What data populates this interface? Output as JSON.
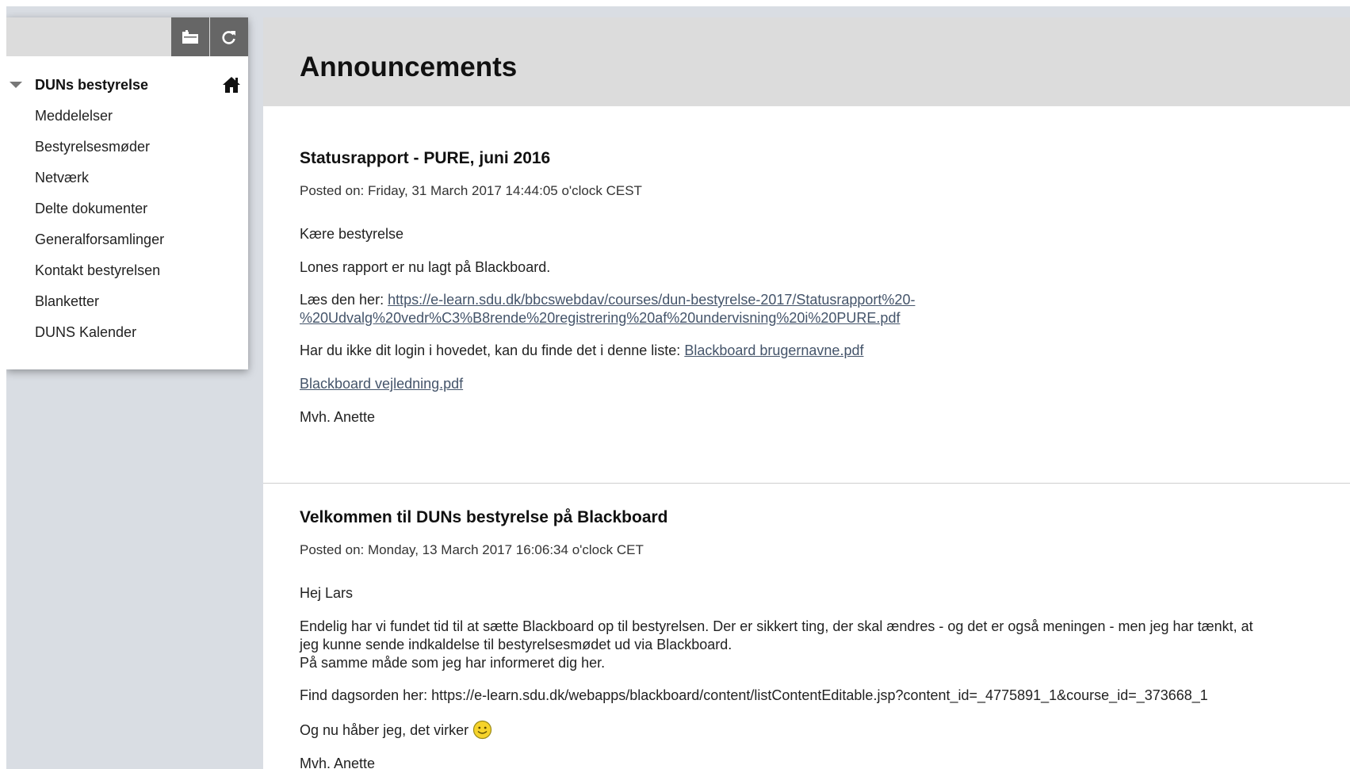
{
  "course_menu": {
    "course_title": "DUNs bestyrelse",
    "items": [
      {
        "label": "Meddelelser"
      },
      {
        "label": "Bestyrelsesmøder"
      },
      {
        "label": "Netværk"
      },
      {
        "label": "Delte dokumenter"
      },
      {
        "label": "Generalforsamlinger"
      },
      {
        "label": "Kontakt bestyrelsen"
      },
      {
        "label": "Blanketter"
      },
      {
        "label": "DUNS Kalender"
      }
    ],
    "icons": {
      "folder_view": "folder-view-icon",
      "refresh": "refresh-icon",
      "collapse": "caret-down-icon",
      "home": "home-icon"
    }
  },
  "page": {
    "title": "Announcements"
  },
  "announcements": [
    {
      "title": "Statusrapport - PURE, juni 2016",
      "posted": "Posted on: Friday, 31 March 2017 14:44:05 o'clock CEST",
      "greeting": "Kære bestyrelse",
      "line1": "Lones rapport er nu lagt på Blackboard.",
      "read_prefix": "Læs den her: ",
      "read_link_line1": "https://e-learn.sdu.dk/bbcswebdav/courses/dun-bestyrelse-2017/Statusrapport%20-",
      "read_link_line2": "%20Udvalg%20vedr%C3%B8rende%20registrering%20af%20undervisning%20i%20PURE.pdf",
      "login_prefix": "Har du ikke dit login i hovedet, kan du finde det i denne liste: ",
      "login_link": "Blackboard brugernavne.pdf",
      "guide_link": "Blackboard vejledning.pdf",
      "signoff": "Mvh. Anette"
    },
    {
      "title": "Velkommen til DUNs bestyrelse på Blackboard",
      "posted": "Posted on: Monday, 13 March 2017 16:06:34 o'clock CET",
      "greeting": "Hej Lars",
      "para_line1": "Endelig har vi fundet tid til at sætte Blackboard op til bestyrelsen. Der er sikkert ting, der skal ændres - og det er også meningen - men jeg har tænkt, at",
      "para_line2": "jeg kunne sende indkaldelse til bestyrelsesmødet ud via Blackboard.",
      "para_line3": "På samme måde som jeg har informeret dig her.",
      "agenda": "Find dagsorden her: https://e-learn.sdu.dk/webapps/blackboard/content/listContentEditable.jsp?content_id=_4775891_1&course_id=_373668_1",
      "hope": "Og nu håber jeg, det virker",
      "hope_icon": "smiley-icon",
      "signoff": "Mvh. Anette"
    }
  ],
  "colors": {
    "toolbar_button_bg": "#666666",
    "header_bg": "#dcdcdc",
    "app_bg": "#d9dde3",
    "link": "#44546a"
  }
}
